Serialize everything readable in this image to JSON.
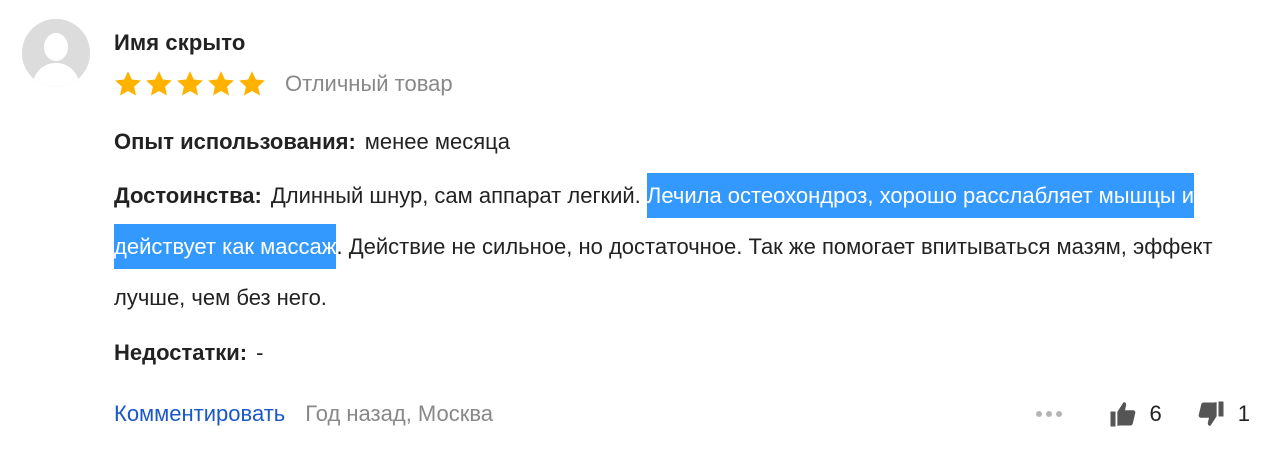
{
  "review": {
    "author": "Имя скрыто",
    "rating": 5,
    "rating_max": 5,
    "rating_label": "Отличный товар",
    "star_color": "#ffb300",
    "experience": {
      "label": "Опыт использования:",
      "value": "менее месяца"
    },
    "pros": {
      "label": "Достоинства:",
      "text_before": "Длинный шнур, сам аппарат легкий.",
      "text_selected": "Лечила остеохондроз, хорошо расслабляет мышцы и действует как массаж",
      "text_after": ". Действие не сильное, но достаточное. Так же помогает впитываться мазям, эффект лучше, чем без него."
    },
    "cons": {
      "label": "Недостатки:",
      "value": "-"
    },
    "footer": {
      "comment_link": "Комментировать",
      "meta": "Год назад, Москва"
    },
    "votes": {
      "up": "6",
      "down": "1"
    },
    "icons": {
      "avatar": "user-silhouette-icon",
      "more": "more-dots-icon",
      "like": "thumbs-up-icon",
      "dislike": "thumbs-down-icon"
    },
    "colors": {
      "link": "#1a58c7",
      "selection": "#3399ff",
      "muted": "#888888"
    }
  }
}
